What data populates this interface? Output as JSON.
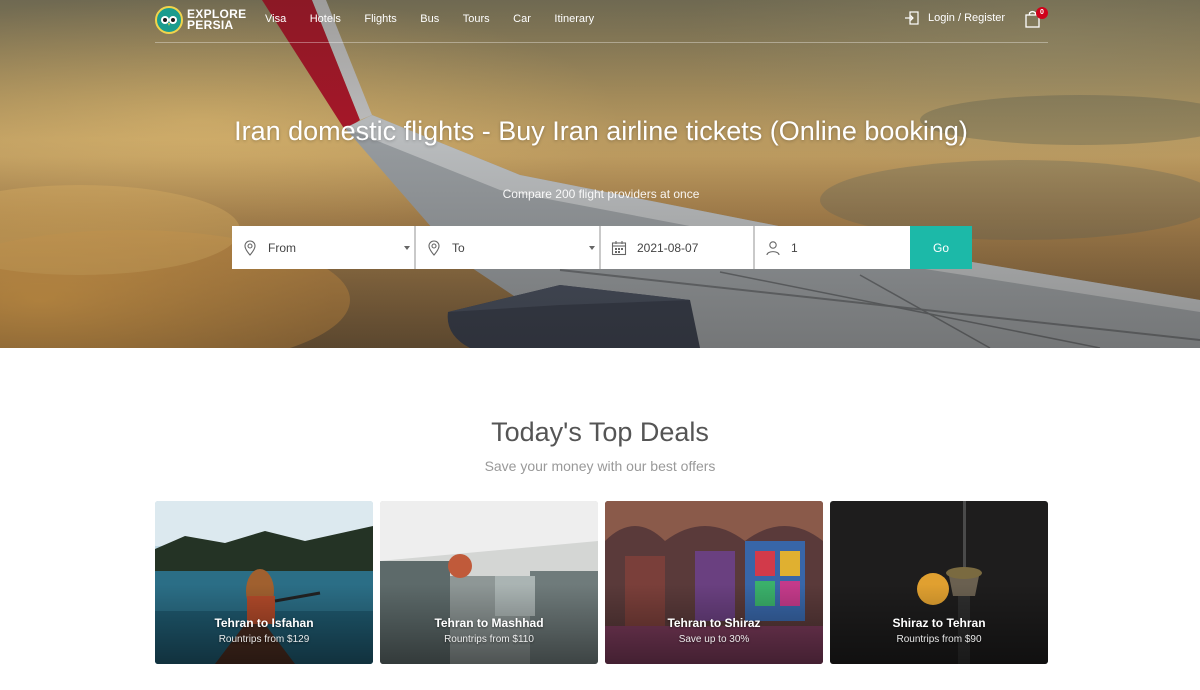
{
  "brand": {
    "line1": "EXPLORE",
    "line2": "PERSIA"
  },
  "nav": {
    "items": [
      "Visa",
      "Hotels",
      "Flights",
      "Bus",
      "Tours",
      "Car",
      "Itinerary"
    ],
    "login_label": "Login / Register",
    "cart_count": "0"
  },
  "hero": {
    "title": "Iran domestic flights - Buy Iran airline tickets (Online booking)",
    "subtitle": "Compare 200 flight providers at once"
  },
  "search": {
    "from_label": "From",
    "to_label": "To",
    "date_value": "2021-08-07",
    "passengers_value": "1",
    "go_label": "Go"
  },
  "deals": {
    "title": "Today's Top Deals",
    "subtitle": "Save your money with our best offers",
    "cards": [
      {
        "title": "Tehran to Isfahan",
        "subtitle": "Rountrips from $129"
      },
      {
        "title": "Tehran to Mashhad",
        "subtitle": "Rountrips from $110"
      },
      {
        "title": "Tehran to Shiraz",
        "subtitle": "Save up to 30%"
      },
      {
        "title": "Shiraz to Tehran",
        "subtitle": "Rountrips from $90"
      }
    ]
  },
  "colors": {
    "accent": "#1cb9a8",
    "badge": "#d0021b"
  },
  "icons": {
    "logo": "owl-logo-icon",
    "login": "login-icon",
    "cart": "shopping-bag-icon",
    "from": "location-pin-icon",
    "to": "location-pin-icon",
    "date": "calendar-icon",
    "passengers": "user-icon"
  }
}
